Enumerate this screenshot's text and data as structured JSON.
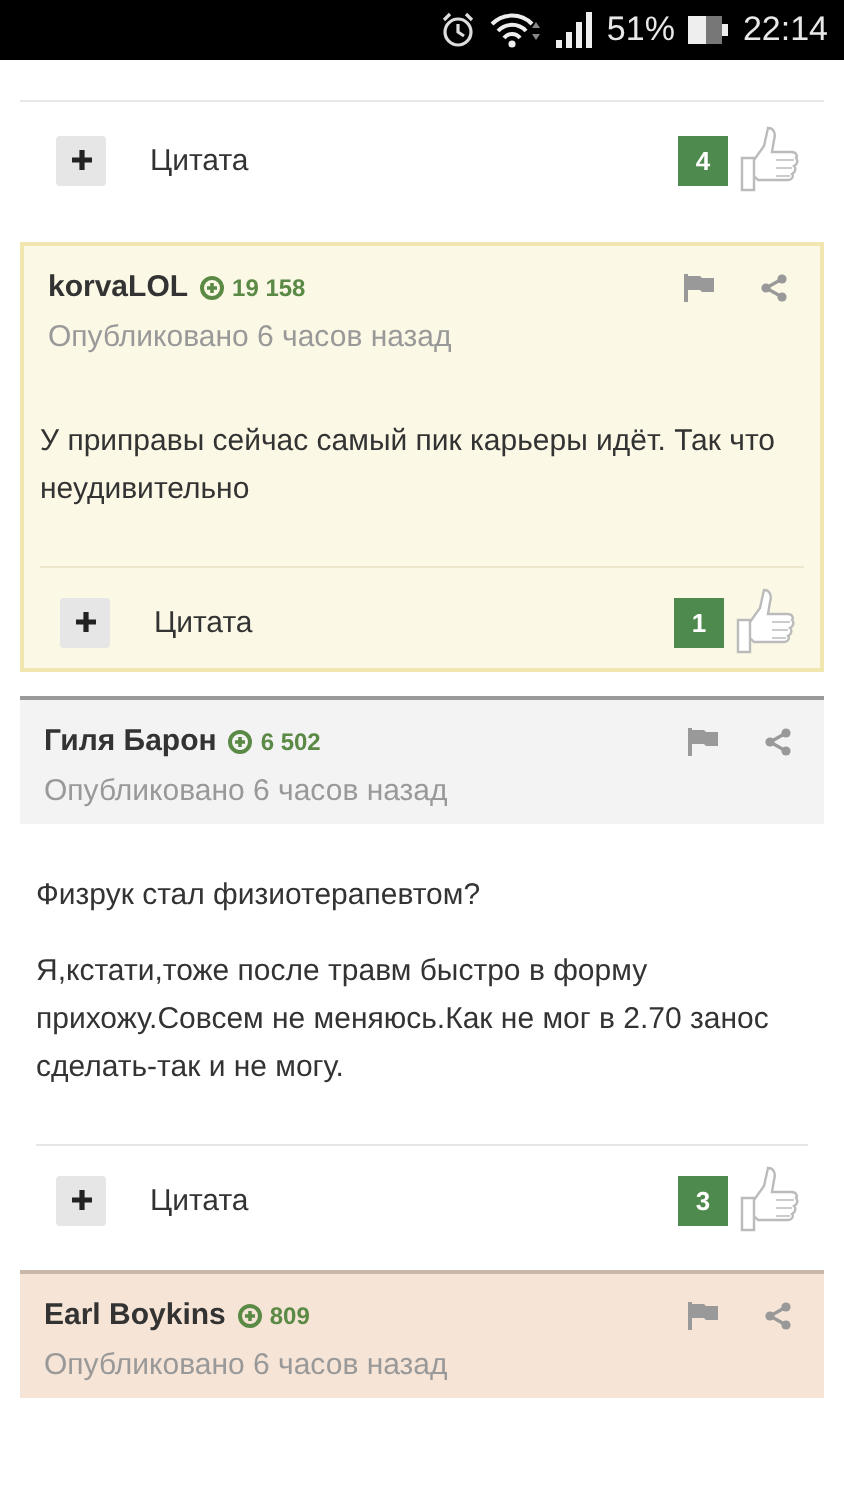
{
  "status_bar": {
    "battery": "51%",
    "time": "22:14"
  },
  "posts": [
    {
      "kind": "tail",
      "quote_label": "Цитата",
      "likes": "4"
    },
    {
      "kind": "highlighted",
      "author": "korvaLOL",
      "reputation": "19 158",
      "posted": "Опубликовано 6 часов назад",
      "paragraphs": [
        "У приправы сейчас самый пик карьеры идёт. Так что неудивительно"
      ],
      "quote_label": "Цитата",
      "likes": "1"
    },
    {
      "kind": "plain",
      "author": "Гиля Барон",
      "reputation": "6 502",
      "posted": "Опубликовано 6 часов назад",
      "paragraphs": [
        "Физрук стал физиотерапевтом?",
        "Я,кстати,тоже после травм быстро в форму прихожу.Совсем не меняюсь.Как не мог в 2.70 занос сделать-так и не могу."
      ],
      "quote_label": "Цитата",
      "likes": "3"
    },
    {
      "kind": "popular",
      "author": "Earl Boykins",
      "reputation": "809",
      "posted": "Опубликовано 6 часов назад"
    }
  ]
}
